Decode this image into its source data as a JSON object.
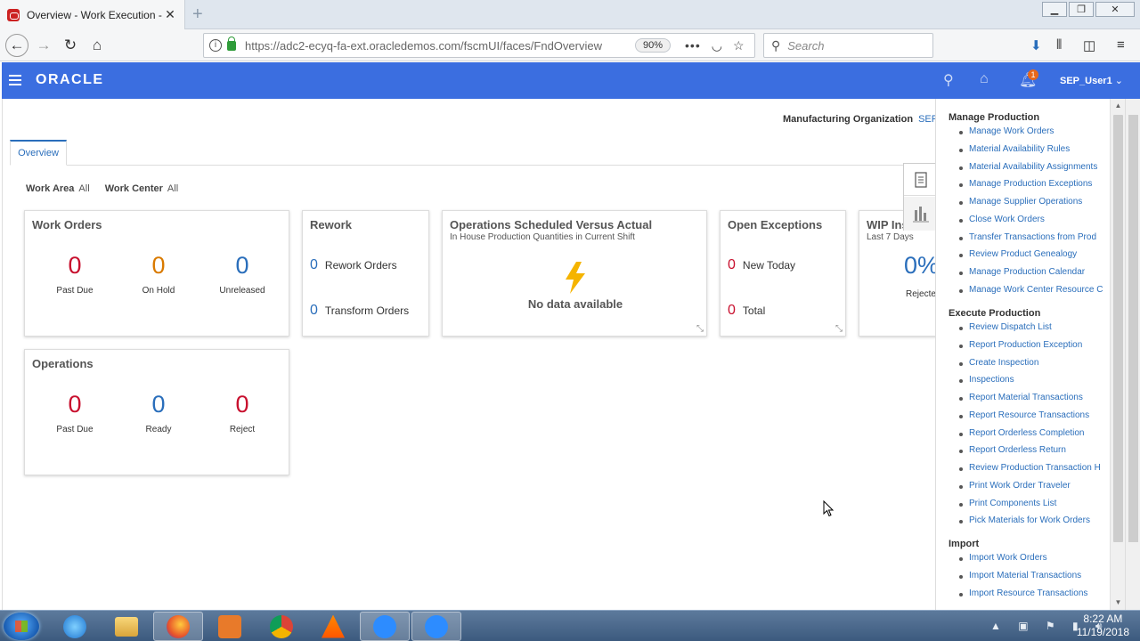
{
  "browser": {
    "tab_title": "Overview - Work Execution - O",
    "url": "https://adc2-ecyq-fa-ext.oracledemos.com/fscmUI/faces/FndOverview",
    "zoom": "90%",
    "search_placeholder": "Search",
    "page_actions": "•••"
  },
  "header": {
    "logo": "ORACLE",
    "notification_count": "1",
    "user": "SEP_User1"
  },
  "page": {
    "mfg_org_label": "Manufacturing Organization",
    "mfg_org_value": "SEP_",
    "tab_overview": "Overview",
    "filters": {
      "work_area_label": "Work Area",
      "work_area_value": "All",
      "work_center_label": "Work Center",
      "work_center_value": "All"
    }
  },
  "cards": {
    "work_orders": {
      "title": "Work Orders",
      "past_due": "0",
      "past_due_label": "Past Due",
      "on_hold": "0",
      "on_hold_label": "On Hold",
      "unreleased": "0",
      "unreleased_label": "Unreleased"
    },
    "rework": {
      "title": "Rework",
      "rework_orders": "0",
      "rework_orders_label": "Rework Orders",
      "transform_orders": "0",
      "transform_orders_label": "Transform Orders"
    },
    "ops_scheduled": {
      "title": "Operations Scheduled Versus Actual",
      "subtitle": "In House Production Quantities in Current Shift",
      "empty": "No data available"
    },
    "open_exceptions": {
      "title": "Open Exceptions",
      "new_today": "0",
      "new_today_label": "New Today",
      "total": "0",
      "total_label": "Total"
    },
    "wip": {
      "title": "WIP Ins",
      "subtitle": "Last 7 Days",
      "value": "0%",
      "label": "Rejecte"
    },
    "operations": {
      "title": "Operations",
      "past_due": "0",
      "past_due_label": "Past Due",
      "ready": "0",
      "ready_label": "Ready",
      "reject": "0",
      "reject_label": "Reject"
    }
  },
  "tasks": {
    "manage_production": {
      "title": "Manage Production",
      "items": [
        "Manage Work Orders",
        "Material Availability Rules",
        "Material Availability Assignments",
        "Manage Production Exceptions",
        "Manage Supplier Operations",
        "Close Work Orders",
        "Transfer Transactions from Prod",
        "Review Product Genealogy",
        "Manage Production Calendar",
        "Manage Work Center Resource C"
      ]
    },
    "execute_production": {
      "title": "Execute Production",
      "items": [
        "Review Dispatch List",
        "Report Production Exception",
        "Create Inspection",
        "Inspections",
        "Report Material Transactions",
        "Report Resource Transactions",
        "Report Orderless Completion",
        "Report Orderless Return",
        "Review Production Transaction H",
        "Print Work Order Traveler",
        "Print Components List",
        "Pick Materials for Work Orders"
      ]
    },
    "import": {
      "title": "Import",
      "items": [
        "Import Work Orders",
        "Import Material Transactions",
        "Import Resource Transactions"
      ]
    }
  },
  "taskbar": {
    "time": "8:22 AM",
    "date": "11/19/2018"
  }
}
